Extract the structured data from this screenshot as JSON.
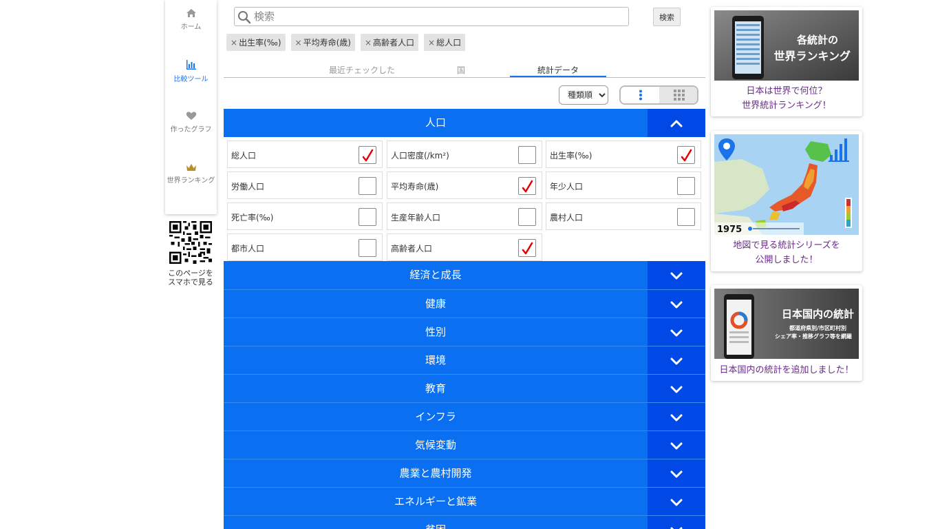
{
  "nav": {
    "items": [
      {
        "label": "ホーム",
        "icon": "home-icon"
      },
      {
        "label": "比較ツール",
        "icon": "bar-chart-icon"
      },
      {
        "label": "作ったグラフ",
        "icon": "heart-icon"
      },
      {
        "label": "世界ランキング",
        "icon": "crown-icon"
      }
    ],
    "qr_caption_1": "このページを",
    "qr_caption_2": "スマホで見る"
  },
  "search": {
    "placeholder": "検索",
    "value": "",
    "button": "検索"
  },
  "chips": [
    {
      "x": "×",
      "label": "出生率(‰)"
    },
    {
      "x": "×",
      "label": "平均寿命(歳)"
    },
    {
      "x": "×",
      "label": "高齢者人口"
    },
    {
      "x": "×",
      "label": "総人口"
    }
  ],
  "tabs": [
    {
      "label": "最近チェックした"
    },
    {
      "label": "国"
    },
    {
      "label": "統計データ"
    }
  ],
  "sort": {
    "selected": "種類順"
  },
  "category_open": {
    "title": "人口"
  },
  "stats": [
    {
      "label": "総人口",
      "checked": true
    },
    {
      "label": "人口密度(/km²)",
      "checked": false
    },
    {
      "label": "出生率(‰)",
      "checked": true
    },
    {
      "label": "労働人口",
      "checked": false
    },
    {
      "label": "平均寿命(歳)",
      "checked": true
    },
    {
      "label": "年少人口",
      "checked": false
    },
    {
      "label": "死亡率(‰)",
      "checked": false
    },
    {
      "label": "生産年齢人口",
      "checked": false
    },
    {
      "label": "農村人口",
      "checked": false
    },
    {
      "label": "都市人口",
      "checked": false
    },
    {
      "label": "高齢者人口",
      "checked": true
    }
  ],
  "categories": [
    {
      "title": "経済と成長"
    },
    {
      "title": "健康"
    },
    {
      "title": "性別"
    },
    {
      "title": "環境"
    },
    {
      "title": "教育"
    },
    {
      "title": "インフラ"
    },
    {
      "title": "気候変動"
    },
    {
      "title": "農業と農村開発"
    },
    {
      "title": "エネルギーと鉱業"
    },
    {
      "title": "貧困"
    }
  ],
  "ads": [
    {
      "img_line1": "各統計の",
      "img_line2": "世界ランキング",
      "cap1": "日本は世界で何位？",
      "cap2": "世界統計ランキング！"
    },
    {
      "img_year": "1975",
      "cap1": "地図で見る統計シリーズを",
      "cap2": "公開しました！"
    },
    {
      "img_line1": "日本国内の統計",
      "img_line2": "都道府県別/市区町村別",
      "img_line3": "シェア率・推移グラフ等を網羅",
      "cap1": "日本国内の統計を追加しました！"
    }
  ],
  "colors": {
    "accent": "#0a6ff0",
    "accent_dark": "#0049e6",
    "check": "#e60000",
    "link": "#6a2a8a"
  }
}
